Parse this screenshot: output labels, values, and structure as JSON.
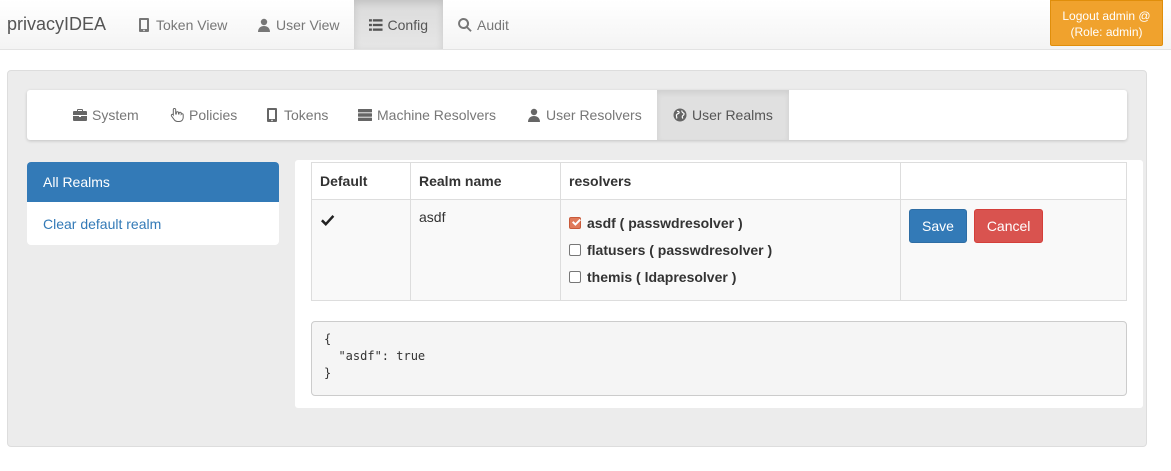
{
  "navbar": {
    "brand": "privacyIDEA",
    "items": [
      {
        "label": "Token View",
        "icon": "phone-icon"
      },
      {
        "label": "User View",
        "icon": "user-icon"
      },
      {
        "label": "Config",
        "icon": "list-icon",
        "active": true
      },
      {
        "label": "Audit",
        "icon": "search-icon"
      }
    ],
    "logout_line1": "Logout admin @",
    "logout_line2": "(Role: admin)"
  },
  "config_tabs": [
    {
      "label": "System",
      "icon": "briefcase-icon"
    },
    {
      "label": "Policies",
      "icon": "hand-pointer-icon"
    },
    {
      "label": "Tokens",
      "icon": "phone-icon"
    },
    {
      "label": "Machine Resolvers",
      "icon": "server-icon"
    },
    {
      "label": "User Resolvers",
      "icon": "user-icon"
    },
    {
      "label": "User Realms",
      "icon": "globe-icon",
      "active": true
    }
  ],
  "side_list": {
    "all_realms": "All Realms",
    "clear_default": "Clear default realm"
  },
  "table": {
    "headers": [
      "Default",
      "Realm name",
      "resolvers",
      ""
    ],
    "row": {
      "default": true,
      "realm_name": "asdf",
      "resolvers": [
        {
          "label": "asdf ( passwdresolver )",
          "checked": true
        },
        {
          "label": "flatusers ( passwdresolver )",
          "checked": false
        },
        {
          "label": "themis ( ldapresolver )",
          "checked": false
        }
      ],
      "save_label": "Save",
      "cancel_label": "Cancel"
    }
  },
  "json_preview": {
    "line1": "{",
    "line2": "  \"asdf\": true",
    "line3": "}"
  },
  "colors": {
    "primary": "#337ab7",
    "danger": "#d9534f",
    "warning": "#f0a22d"
  }
}
